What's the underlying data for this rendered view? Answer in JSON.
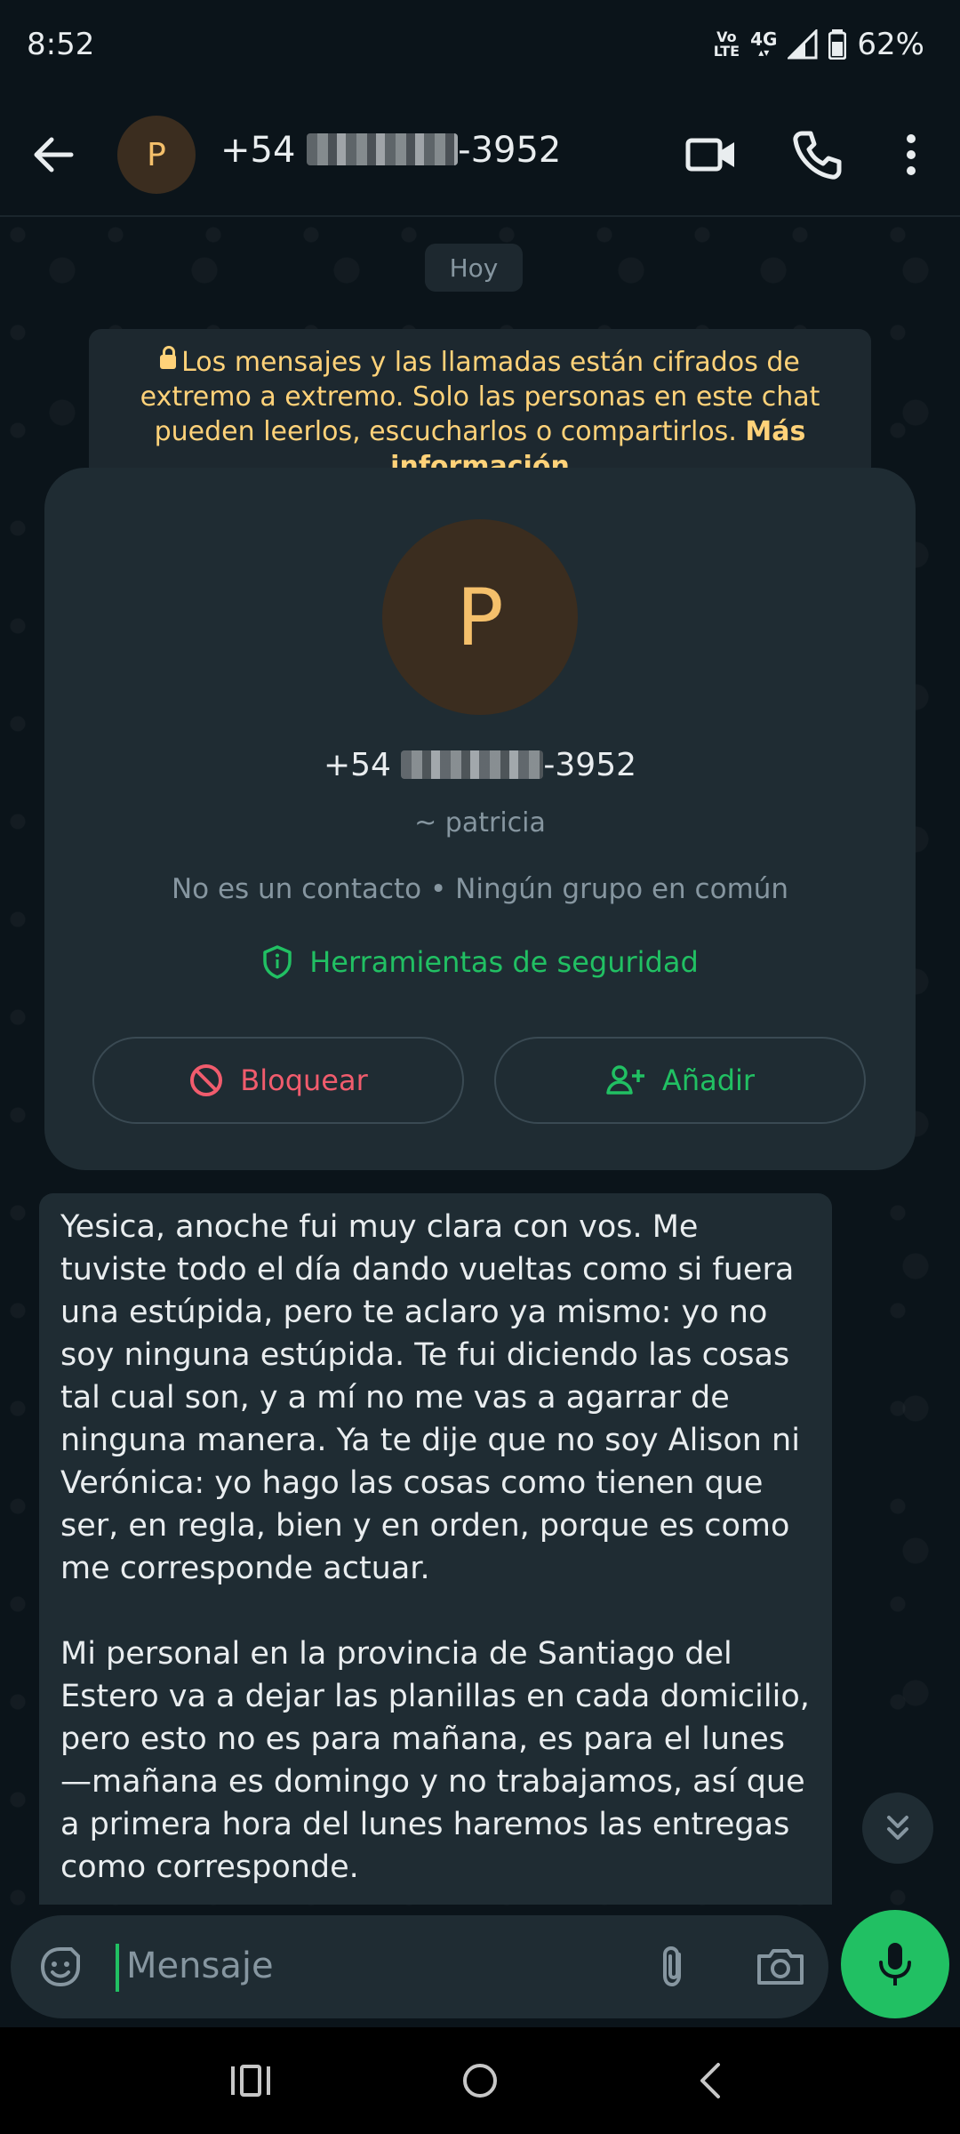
{
  "status_bar": {
    "time": "8:52",
    "volte_line1": "Vo",
    "volte_line2": "LTE",
    "network": "4G",
    "battery": "62%"
  },
  "header": {
    "avatar_initial": "P",
    "phone_prefix": "+54",
    "phone_suffix": "-3952"
  },
  "chat": {
    "date_chip": "Hoy",
    "encryption_notice": "Los mensajes y las llamadas están cifrados de extremo a extremo. Solo las personas en este chat pueden leerlos, escucharlos o compartirlos.",
    "encryption_link": "Más información",
    "contact_card": {
      "avatar_initial": "P",
      "phone_prefix": "+54",
      "phone_suffix": "-3952",
      "name": "~ patricia",
      "meta": "No es un contacto • Ningún grupo en común",
      "safety_tools": "Herramientas de seguridad",
      "block_label": "Bloquear",
      "add_label": "Añadir"
    },
    "message": {
      "paragraph1": "Yesica, anoche fui muy clara con vos. Me tuviste todo el día dando vueltas como si fuera una estúpida, pero te aclaro ya mismo: yo no soy ninguna estúpida. Te fui diciendo las cosas tal cual son, y a mí no me vas a agarrar de ninguna manera. Ya te dije que no soy Alison ni Verónica: yo hago las cosas como tienen que ser, en regla, bien y en orden, porque es como me corresponde actuar.",
      "paragraph2": "Mi personal en la provincia de Santiago del Estero va a dejar las planillas en cada domicilio, pero esto no es para mañana, es para el lunes —mañana es domingo y no trabajamos, así que a primera hora del lunes haremos las entregas como corresponde."
    }
  },
  "composer": {
    "placeholder": "Mensaje"
  },
  "colors": {
    "background": "#0b141a",
    "bubble": "#1f2c33",
    "accent_green": "#21c063",
    "danger_red": "#f15c6d",
    "notice_yellow": "#ffd279"
  },
  "icons": [
    "back-arrow-icon",
    "video-call-icon",
    "phone-call-icon",
    "more-vert-icon",
    "lock-icon",
    "shield-icon",
    "block-icon",
    "add-person-icon",
    "chevron-double-down-icon",
    "sticker-icon",
    "paperclip-icon",
    "camera-icon",
    "mic-icon",
    "recents-icon",
    "home-icon",
    "nav-back-icon"
  ]
}
